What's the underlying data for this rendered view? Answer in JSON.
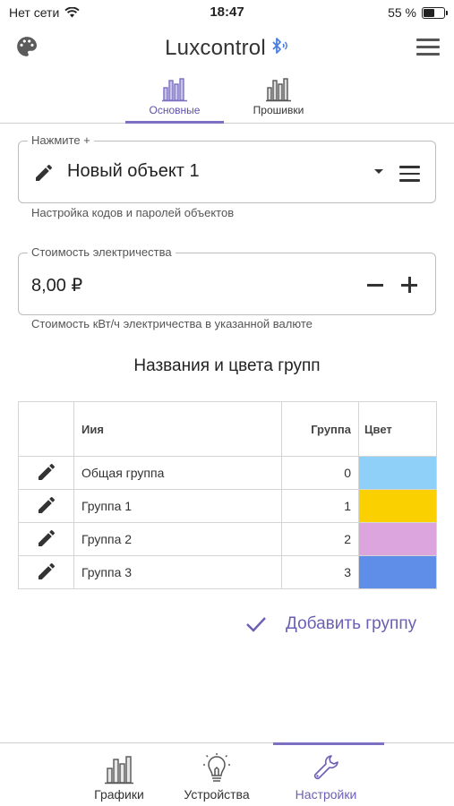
{
  "status_bar": {
    "carrier": "Нет сети",
    "time": "18:47",
    "battery": "55 %",
    "battery_level": 0.55
  },
  "header": {
    "title": "Luxcontrol",
    "icons": [
      "palette-icon",
      "bluetooth-icon",
      "menu-icon"
    ]
  },
  "tabs": [
    {
      "label": "Основные",
      "active": true,
      "icon": "chart-bars-icon"
    },
    {
      "label": "Прошивки",
      "active": false,
      "icon": "chart-bars-icon"
    }
  ],
  "object_field": {
    "legend": "Нажмите +",
    "value": "Новый объект 1",
    "helper": "Настройка кодов и паролей объектов"
  },
  "cost_field": {
    "legend": "Стоимость электричества",
    "value": "8,00 ₽",
    "helper": "Стоимость кВт/ч электричества в указанной валюте"
  },
  "groups_section": {
    "title": "Названия и цвета групп",
    "columns": {
      "name": "Иия",
      "group": "Группа",
      "color": "Цвет"
    },
    "rows": [
      {
        "name": "Общая группа",
        "group": "0",
        "color": "#8fd0f8"
      },
      {
        "name": "Группа 1",
        "group": "1",
        "color": "#fad000"
      },
      {
        "name": "Группа 2",
        "group": "2",
        "color": "#dca5de"
      },
      {
        "name": "Группа 3",
        "group": "3",
        "color": "#5f8ee8"
      }
    ],
    "add_label": "Добавить группу"
  },
  "bottom_nav": [
    {
      "label": "Графики",
      "icon": "chart-bars-icon",
      "active": false
    },
    {
      "label": "Устройства",
      "icon": "lightbulb-icon",
      "active": false
    },
    {
      "label": "Настройки",
      "icon": "wrench-icon",
      "active": true
    }
  ],
  "colors": {
    "accent": "#6a5fb5",
    "border": "#bdbdbd"
  }
}
